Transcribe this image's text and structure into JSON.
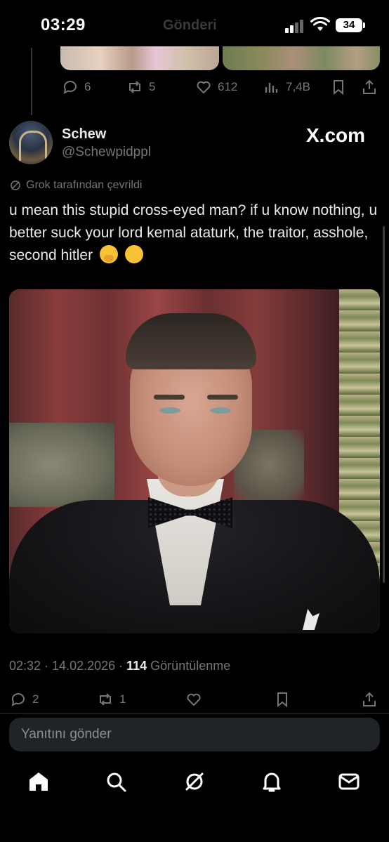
{
  "status_bar": {
    "time": "03:29",
    "ghost_title": "Gönderi",
    "battery": "34"
  },
  "previous_post": {
    "actions": {
      "replies": "6",
      "reposts": "5",
      "likes": "612",
      "views": "7,4B"
    }
  },
  "post": {
    "author_name": "Schew",
    "author_handle": "@Schewpidppl",
    "watermark": "X.com",
    "translated_label": "Grok tarafından çevrildi",
    "text": "u mean this stupid cross-eyed man? if u know nothing, u better suck your lord kemal ataturk, the traitor, asshole, second hitler",
    "timestamp": "02:32 · 14.02.2026 · ",
    "views_count": "114",
    "views_label": " Görüntülenme",
    "actions": {
      "replies": "2",
      "reposts": "1"
    }
  },
  "reply": {
    "placeholder": "Yanıtını gönder"
  },
  "bottom_nav": [
    "home-icon",
    "search-icon",
    "grok-icon",
    "notifications-icon",
    "messages-icon"
  ],
  "colors": {
    "background": "#000000",
    "text": "#e7e9ea",
    "muted": "#71767b"
  }
}
